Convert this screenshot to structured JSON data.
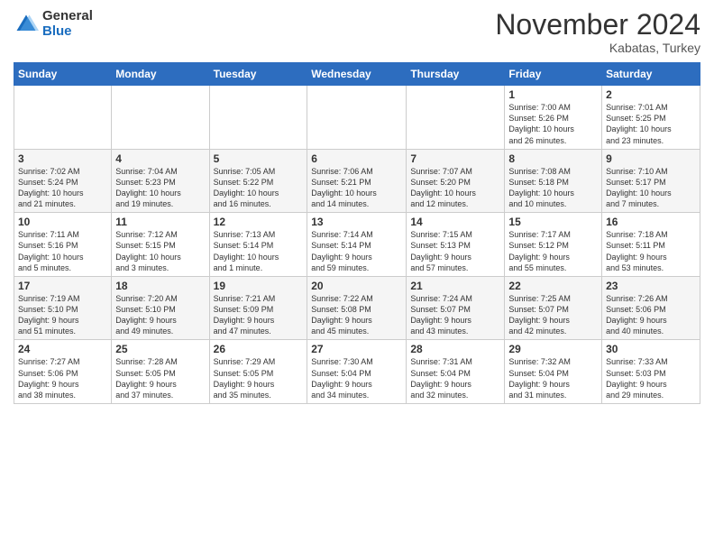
{
  "logo": {
    "general": "General",
    "blue": "Blue"
  },
  "header": {
    "month": "November 2024",
    "location": "Kabatas, Turkey"
  },
  "weekdays": [
    "Sunday",
    "Monday",
    "Tuesday",
    "Wednesday",
    "Thursday",
    "Friday",
    "Saturday"
  ],
  "weeks": [
    [
      {
        "day": "",
        "info": ""
      },
      {
        "day": "",
        "info": ""
      },
      {
        "day": "",
        "info": ""
      },
      {
        "day": "",
        "info": ""
      },
      {
        "day": "",
        "info": ""
      },
      {
        "day": "1",
        "info": "Sunrise: 7:00 AM\nSunset: 5:26 PM\nDaylight: 10 hours\nand 26 minutes."
      },
      {
        "day": "2",
        "info": "Sunrise: 7:01 AM\nSunset: 5:25 PM\nDaylight: 10 hours\nand 23 minutes."
      }
    ],
    [
      {
        "day": "3",
        "info": "Sunrise: 7:02 AM\nSunset: 5:24 PM\nDaylight: 10 hours\nand 21 minutes."
      },
      {
        "day": "4",
        "info": "Sunrise: 7:04 AM\nSunset: 5:23 PM\nDaylight: 10 hours\nand 19 minutes."
      },
      {
        "day": "5",
        "info": "Sunrise: 7:05 AM\nSunset: 5:22 PM\nDaylight: 10 hours\nand 16 minutes."
      },
      {
        "day": "6",
        "info": "Sunrise: 7:06 AM\nSunset: 5:21 PM\nDaylight: 10 hours\nand 14 minutes."
      },
      {
        "day": "7",
        "info": "Sunrise: 7:07 AM\nSunset: 5:20 PM\nDaylight: 10 hours\nand 12 minutes."
      },
      {
        "day": "8",
        "info": "Sunrise: 7:08 AM\nSunset: 5:18 PM\nDaylight: 10 hours\nand 10 minutes."
      },
      {
        "day": "9",
        "info": "Sunrise: 7:10 AM\nSunset: 5:17 PM\nDaylight: 10 hours\nand 7 minutes."
      }
    ],
    [
      {
        "day": "10",
        "info": "Sunrise: 7:11 AM\nSunset: 5:16 PM\nDaylight: 10 hours\nand 5 minutes."
      },
      {
        "day": "11",
        "info": "Sunrise: 7:12 AM\nSunset: 5:15 PM\nDaylight: 10 hours\nand 3 minutes."
      },
      {
        "day": "12",
        "info": "Sunrise: 7:13 AM\nSunset: 5:14 PM\nDaylight: 10 hours\nand 1 minute."
      },
      {
        "day": "13",
        "info": "Sunrise: 7:14 AM\nSunset: 5:14 PM\nDaylight: 9 hours\nand 59 minutes."
      },
      {
        "day": "14",
        "info": "Sunrise: 7:15 AM\nSunset: 5:13 PM\nDaylight: 9 hours\nand 57 minutes."
      },
      {
        "day": "15",
        "info": "Sunrise: 7:17 AM\nSunset: 5:12 PM\nDaylight: 9 hours\nand 55 minutes."
      },
      {
        "day": "16",
        "info": "Sunrise: 7:18 AM\nSunset: 5:11 PM\nDaylight: 9 hours\nand 53 minutes."
      }
    ],
    [
      {
        "day": "17",
        "info": "Sunrise: 7:19 AM\nSunset: 5:10 PM\nDaylight: 9 hours\nand 51 minutes."
      },
      {
        "day": "18",
        "info": "Sunrise: 7:20 AM\nSunset: 5:10 PM\nDaylight: 9 hours\nand 49 minutes."
      },
      {
        "day": "19",
        "info": "Sunrise: 7:21 AM\nSunset: 5:09 PM\nDaylight: 9 hours\nand 47 minutes."
      },
      {
        "day": "20",
        "info": "Sunrise: 7:22 AM\nSunset: 5:08 PM\nDaylight: 9 hours\nand 45 minutes."
      },
      {
        "day": "21",
        "info": "Sunrise: 7:24 AM\nSunset: 5:07 PM\nDaylight: 9 hours\nand 43 minutes."
      },
      {
        "day": "22",
        "info": "Sunrise: 7:25 AM\nSunset: 5:07 PM\nDaylight: 9 hours\nand 42 minutes."
      },
      {
        "day": "23",
        "info": "Sunrise: 7:26 AM\nSunset: 5:06 PM\nDaylight: 9 hours\nand 40 minutes."
      }
    ],
    [
      {
        "day": "24",
        "info": "Sunrise: 7:27 AM\nSunset: 5:06 PM\nDaylight: 9 hours\nand 38 minutes."
      },
      {
        "day": "25",
        "info": "Sunrise: 7:28 AM\nSunset: 5:05 PM\nDaylight: 9 hours\nand 37 minutes."
      },
      {
        "day": "26",
        "info": "Sunrise: 7:29 AM\nSunset: 5:05 PM\nDaylight: 9 hours\nand 35 minutes."
      },
      {
        "day": "27",
        "info": "Sunrise: 7:30 AM\nSunset: 5:04 PM\nDaylight: 9 hours\nand 34 minutes."
      },
      {
        "day": "28",
        "info": "Sunrise: 7:31 AM\nSunset: 5:04 PM\nDaylight: 9 hours\nand 32 minutes."
      },
      {
        "day": "29",
        "info": "Sunrise: 7:32 AM\nSunset: 5:04 PM\nDaylight: 9 hours\nand 31 minutes."
      },
      {
        "day": "30",
        "info": "Sunrise: 7:33 AM\nSunset: 5:03 PM\nDaylight: 9 hours\nand 29 minutes."
      }
    ]
  ]
}
